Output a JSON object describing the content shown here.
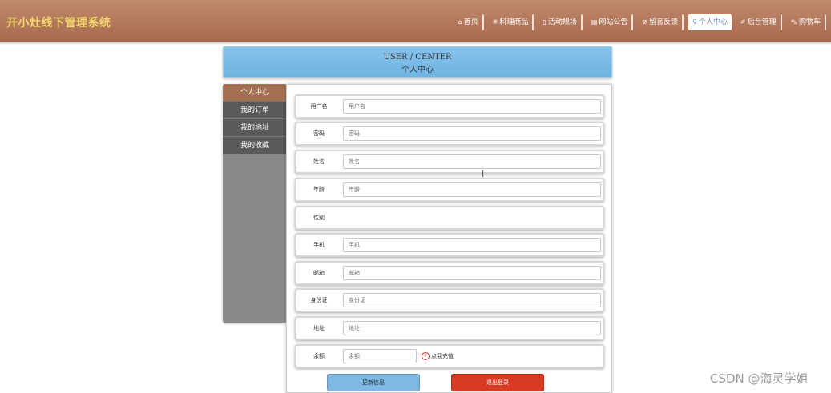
{
  "app": {
    "title": "开小灶线下管理系统"
  },
  "nav": [
    {
      "icon": "⌂",
      "label": "首页",
      "active": false,
      "name": "nav-home"
    },
    {
      "icon": "❄",
      "label": "料理商品",
      "active": false,
      "name": "nav-products"
    },
    {
      "icon": "▯",
      "label": "活动规场",
      "active": false,
      "name": "nav-events"
    },
    {
      "icon": "▤",
      "label": "网站公告",
      "active": false,
      "name": "nav-notice"
    },
    {
      "icon": "⊘",
      "label": "留言反馈",
      "active": false,
      "name": "nav-feedback"
    },
    {
      "icon": "⚲",
      "label": "个人中心",
      "active": true,
      "name": "nav-user-center"
    },
    {
      "icon": "✐",
      "label": "后台管理",
      "active": false,
      "name": "nav-admin"
    },
    {
      "icon": "⛍",
      "label": "购物车",
      "active": false,
      "name": "nav-cart"
    }
  ],
  "banner": {
    "en": "USER / CENTER",
    "cn": "个人中心"
  },
  "sidebar": {
    "items": [
      "个人中心",
      "我的订单",
      "我的地址",
      "我的收藏"
    ]
  },
  "form": {
    "fields": [
      {
        "label": "用户名",
        "placeholder": "用户名"
      },
      {
        "label": "密码",
        "placeholder": "密码"
      },
      {
        "label": "姓名",
        "placeholder": "姓名"
      },
      {
        "label": "年龄",
        "placeholder": "年龄"
      },
      {
        "label": "性别",
        "placeholder": ""
      },
      {
        "label": "手机",
        "placeholder": "手机"
      },
      {
        "label": "邮箱",
        "placeholder": "邮箱"
      },
      {
        "label": "身份证",
        "placeholder": "身份证"
      },
      {
        "label": "地址",
        "placeholder": "地址"
      },
      {
        "label": "余额",
        "placeholder": "余额"
      }
    ],
    "recharge_icon": "¥",
    "recharge_label": "点我充值",
    "update_button": "更新信息",
    "logout_button": "退出登录"
  },
  "watermark": "CSDN @海灵学姐",
  "colors": {
    "topbar": "#a8694c",
    "brand": "#f5d76e",
    "banner": "#7ab9e6",
    "sidebar_active": "#a56f52",
    "update_button": "#7db9e3",
    "logout_button": "#d93a24"
  }
}
